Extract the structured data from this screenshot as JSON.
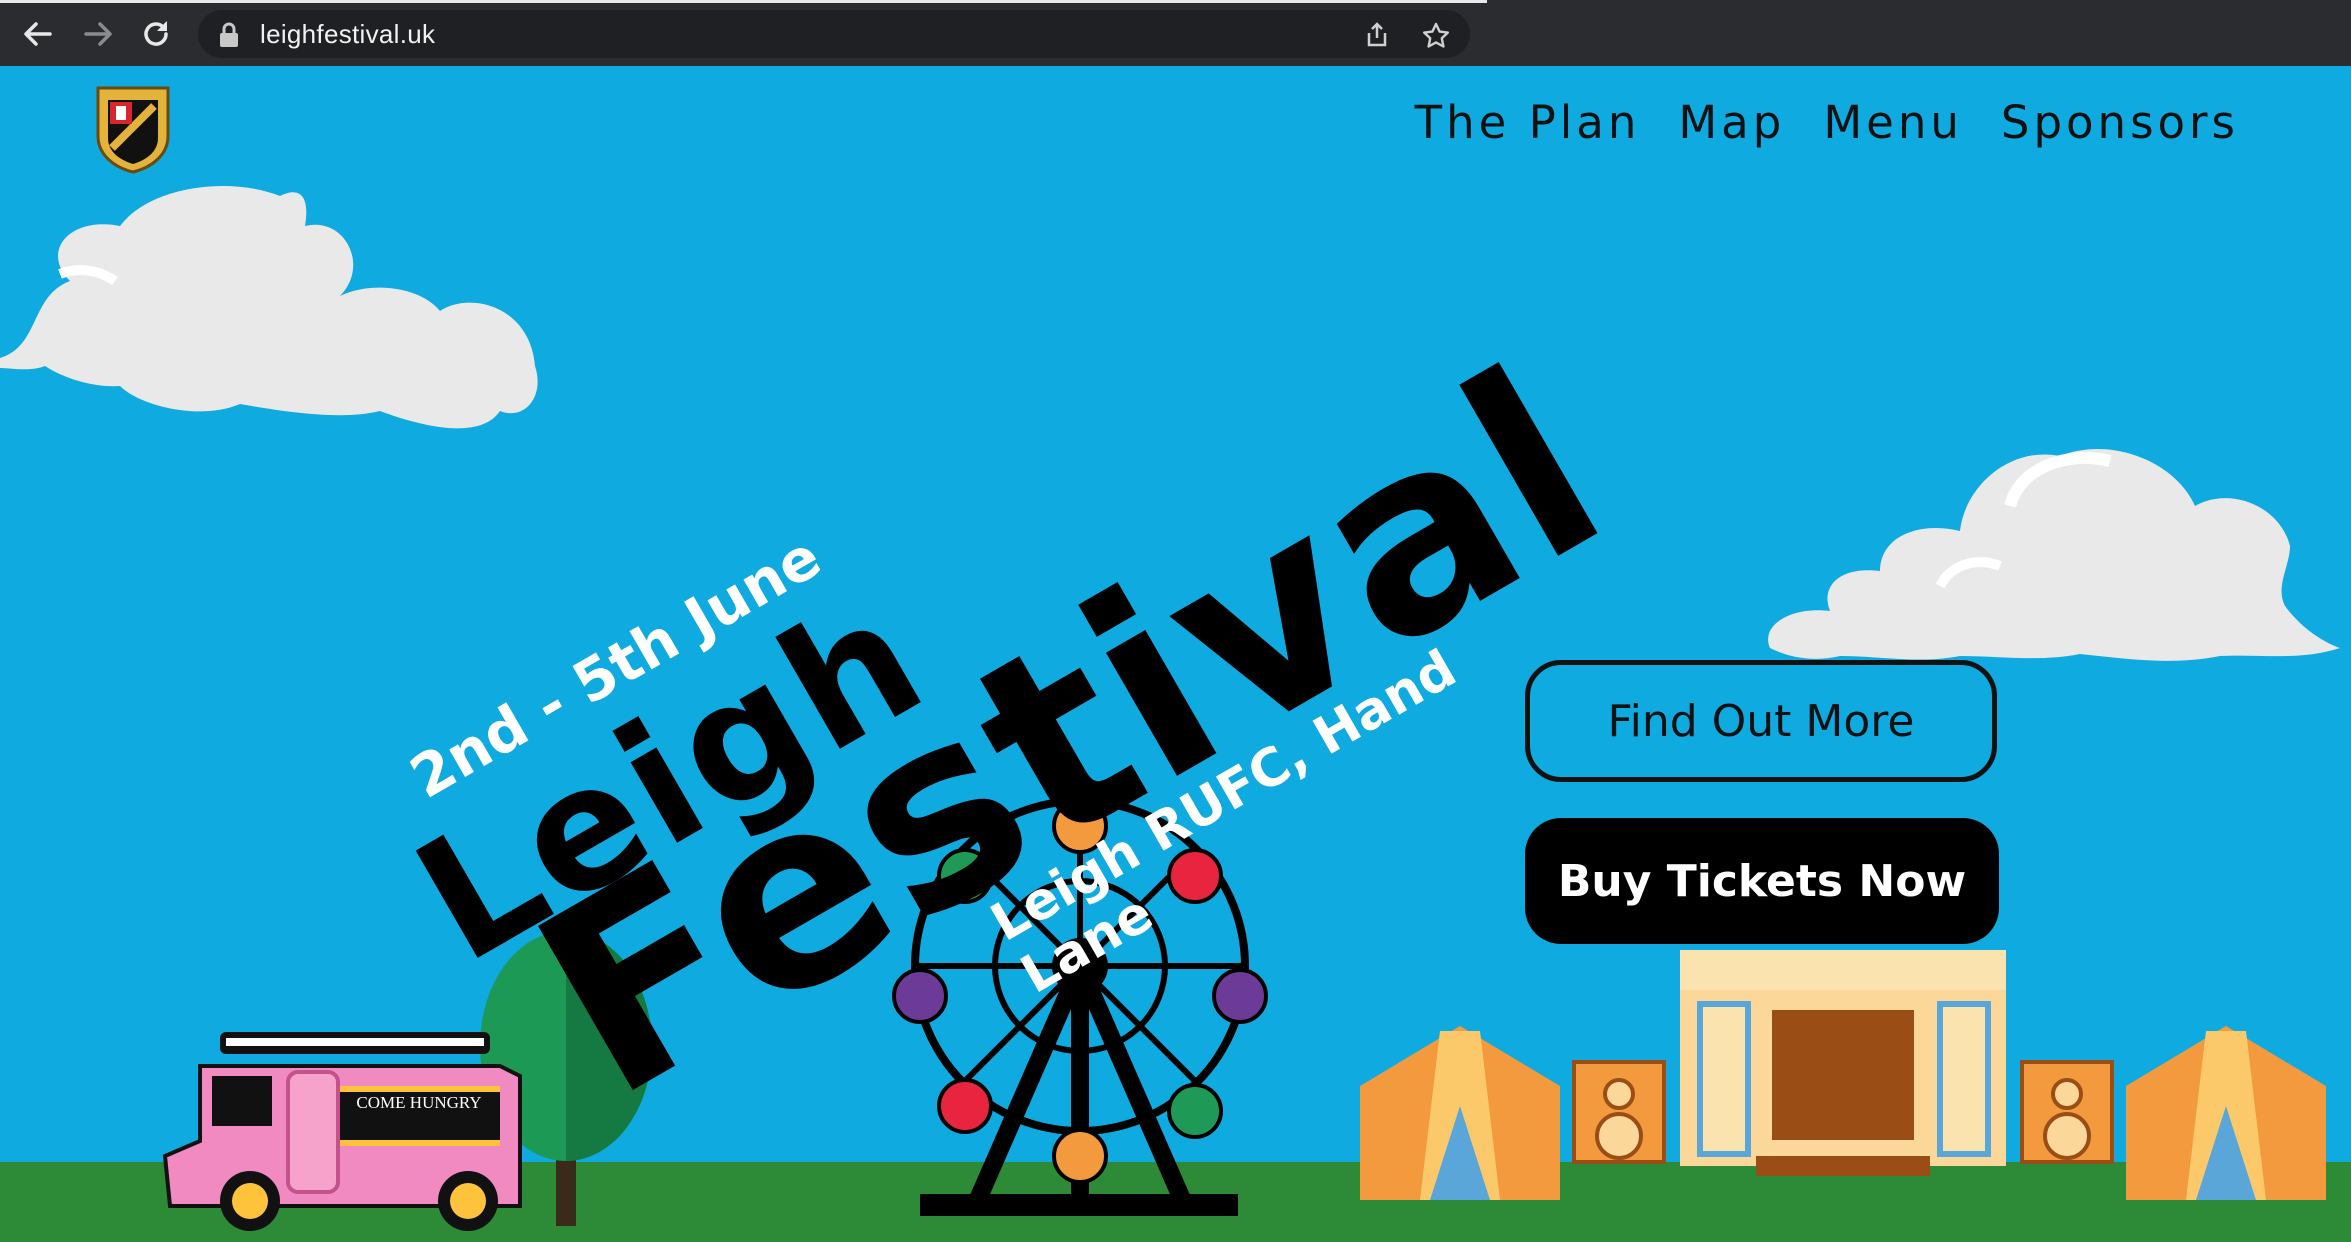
{
  "browser": {
    "url": "leighfestival.uk",
    "icons": [
      "back-arrow-icon",
      "forward-arrow-icon",
      "reload-icon",
      "lock-icon",
      "share-icon",
      "bookmark-star-icon"
    ]
  },
  "header": {
    "nav": [
      {
        "label": "The Plan"
      },
      {
        "label": "Map"
      },
      {
        "label": "Menu"
      },
      {
        "label": "Sponsors"
      }
    ]
  },
  "hero": {
    "date": "2nd - 5th June",
    "title_line1": "Leigh",
    "title_line2": "Festival",
    "venue": "Leigh RUFC, Hand Lane",
    "van_sign": "COME HUNGRY"
  },
  "actions": {
    "find_out_more": "Find Out More",
    "buy_tickets": "Buy Tickets Now"
  },
  "colors": {
    "sky": "#0eaae0",
    "grass": "#2d8a36",
    "button_dark": "#000000"
  }
}
